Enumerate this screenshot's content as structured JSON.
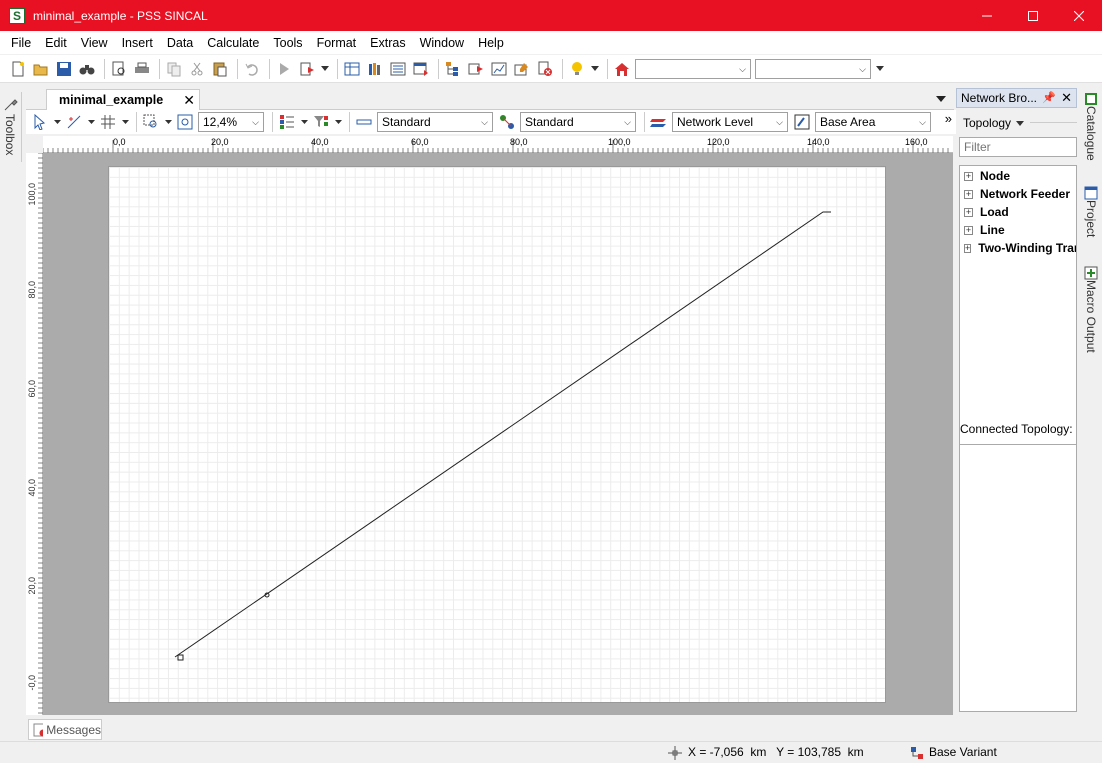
{
  "window": {
    "title": "minimal_example - PSS SINCAL",
    "app_icon_letter": "S"
  },
  "menu": [
    "File",
    "Edit",
    "View",
    "Insert",
    "Data",
    "Calculate",
    "Tools",
    "Format",
    "Extras",
    "Window",
    "Help"
  ],
  "left_dock": {
    "toolbox_label": "Toolbox"
  },
  "document": {
    "tab_label": "minimal_example",
    "zoom": "12,4%",
    "style_combo_1": "Standard",
    "style_combo_2": "Standard",
    "level_combo": "Network Level",
    "area_combo": "Base Area"
  },
  "ruler": {
    "h_labels": [
      "0,0",
      "20,0",
      "40,0",
      "60,0",
      "80,0",
      "100,0",
      "120,0",
      "140,0",
      "160,0"
    ],
    "v_labels": [
      "100,0",
      "80,0",
      "60,0",
      "40,0",
      "20,0",
      "-0,0"
    ]
  },
  "network_browser": {
    "title": "Network Bro...",
    "dropdown_label": "Topology",
    "filter_placeholder": "Filter",
    "tree_items": [
      "Node",
      "Network Feeder",
      "Load",
      "Line",
      "Two-Winding Tran"
    ],
    "connected_label": "Connected Topology:"
  },
  "right_tabs": {
    "catalogue": "Catalogue",
    "project": "Project",
    "macro": "Macro Output"
  },
  "messages_tab": "Messages",
  "status": {
    "coords": "X = -7,056  km   Y = 103,785  km",
    "variant": "Base Variant"
  },
  "colors": {
    "titlebar": "#e81123",
    "panel_header": "#dde4ef"
  }
}
